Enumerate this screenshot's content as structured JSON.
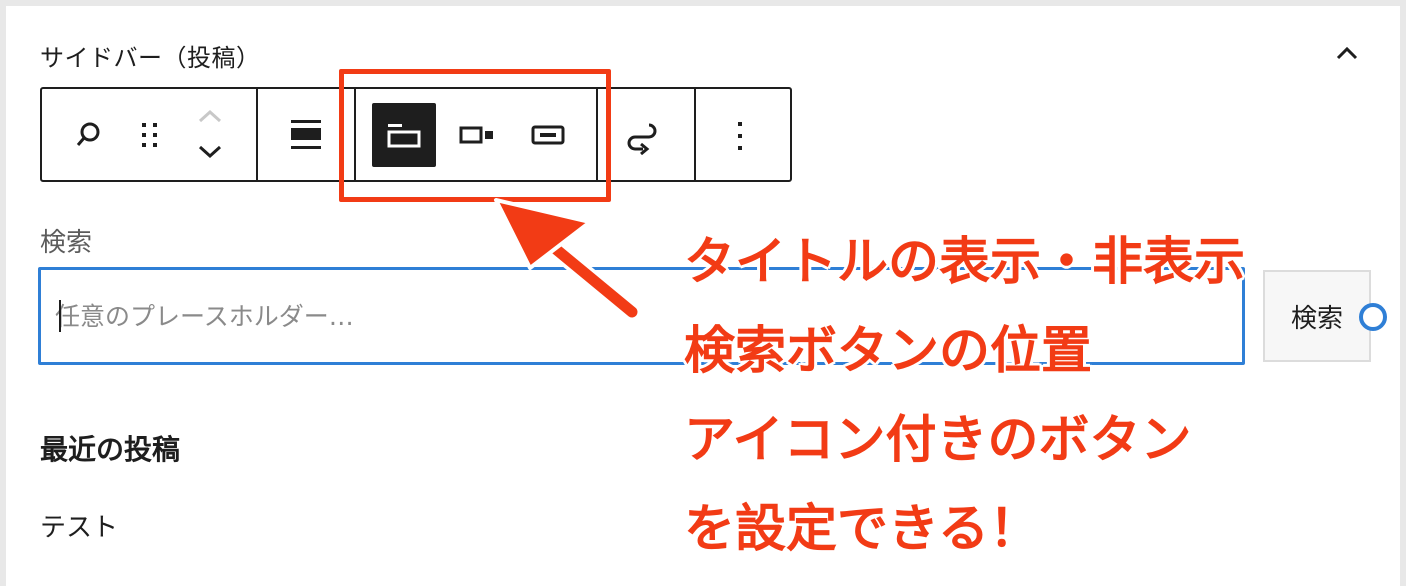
{
  "panel": {
    "title": "サイドバー（投稿）"
  },
  "toolbar": {
    "buttons": [
      {
        "name": "search-block-icon",
        "active": false
      },
      {
        "name": "drag-handle-icon",
        "active": false
      },
      {
        "name": "move-up-down-icon",
        "active": false
      },
      {
        "name": "align-icon",
        "active": false
      },
      {
        "name": "toggle-label-icon",
        "active": true
      },
      {
        "name": "button-position-icon",
        "active": false
      },
      {
        "name": "button-only-icon",
        "active": false
      },
      {
        "name": "transform-icon",
        "active": false
      },
      {
        "name": "more-options-icon",
        "active": false
      }
    ],
    "accent_active_bg": "#1e1e1e"
  },
  "search": {
    "label": "検索",
    "placeholder": "任意のプレースホルダー…",
    "button_label": "検索"
  },
  "recent_posts": {
    "heading": "最近の投稿",
    "items": [
      "テスト"
    ]
  },
  "annotation": {
    "lines": [
      "タイトルの表示・非表示",
      "検索ボタンの位置",
      "アイコン付きのボタン",
      "を設定できる！"
    ],
    "color": "#f23b15"
  },
  "colors": {
    "focus_blue": "#2f7fd6",
    "text": "#1e1e1e",
    "muted": "#5c5c5c"
  }
}
